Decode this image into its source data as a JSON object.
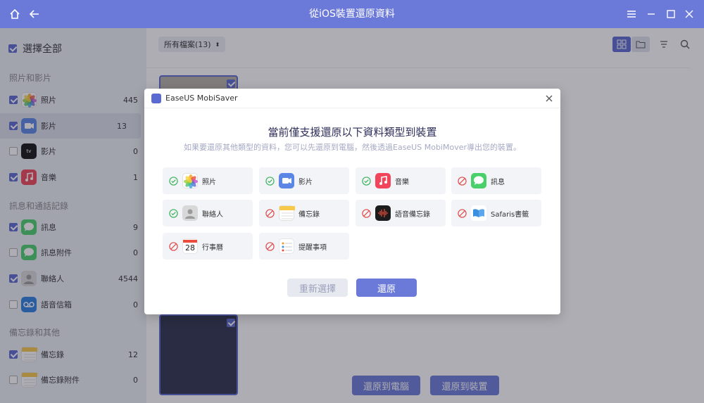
{
  "window": {
    "title": "從iOS裝置還原資料"
  },
  "sidebar": {
    "select_all": "選擇全部",
    "sections": [
      "照片和影片",
      "訊息和通話記錄",
      "備忘錄和其他"
    ],
    "items": [
      {
        "label": "照片",
        "count": "445",
        "checked": true,
        "icon": "photos-icon"
      },
      {
        "label": "影片",
        "count": "13",
        "checked": true,
        "icon": "video-icon"
      },
      {
        "label": "影片",
        "count": "0",
        "checked": false,
        "icon": "apple-tv-icon"
      },
      {
        "label": "音樂",
        "count": "1",
        "checked": true,
        "icon": "music-icon"
      },
      {
        "label": "訊息",
        "count": "9",
        "checked": true,
        "icon": "messages-icon"
      },
      {
        "label": "訊息附件",
        "count": "0",
        "checked": false,
        "icon": "messages-icon"
      },
      {
        "label": "聯絡人",
        "count": "4544",
        "checked": true,
        "icon": "contacts-icon"
      },
      {
        "label": "語音信箱",
        "count": "0",
        "checked": false,
        "icon": "voicemail-icon"
      },
      {
        "label": "備忘錄",
        "count": "12",
        "checked": true,
        "icon": "notes-icon"
      },
      {
        "label": "備忘錄附件",
        "count": "0",
        "checked": false,
        "icon": "notes-icon"
      }
    ],
    "tv_icon_text": "tv"
  },
  "main": {
    "filter_label": "所有檔案(13)",
    "restore_to_pc": "還原到電腦",
    "restore_to_device": "還原到裝置"
  },
  "modal": {
    "title": "EaseUS MobiSaver",
    "heading": "當前僅支援還原以下資料類型到裝置",
    "subheading": "如果要還原其他類型的資料，您可以先還原到電腦，然後透過EaseUS MobiMover導出您的裝置。",
    "cards": [
      {
        "label": "照片",
        "supported": true,
        "icon": "photos-icon"
      },
      {
        "label": "影片",
        "supported": true,
        "icon": "video-icon"
      },
      {
        "label": "音樂",
        "supported": true,
        "icon": "music-icon"
      },
      {
        "label": "訊息",
        "supported": false,
        "icon": "messages-icon"
      },
      {
        "label": "聯絡人",
        "supported": true,
        "icon": "contacts-icon"
      },
      {
        "label": "備忘錄",
        "supported": false,
        "icon": "notes-icon"
      },
      {
        "label": "語音備忘錄",
        "supported": false,
        "icon": "voice-memos-icon"
      },
      {
        "label": "Safaris書籤",
        "supported": false,
        "icon": "books-icon"
      },
      {
        "label": "行事曆",
        "supported": false,
        "icon": "calendar-icon"
      },
      {
        "label": "提醒事項",
        "supported": false,
        "icon": "reminders-icon"
      }
    ],
    "calendar_day": "28",
    "reselect_button": "重新選擇",
    "restore_button": "還原"
  },
  "colors": {
    "accent": "#6b79d8",
    "supported": "#3cb35a",
    "unsupported": "#e04a4a"
  }
}
